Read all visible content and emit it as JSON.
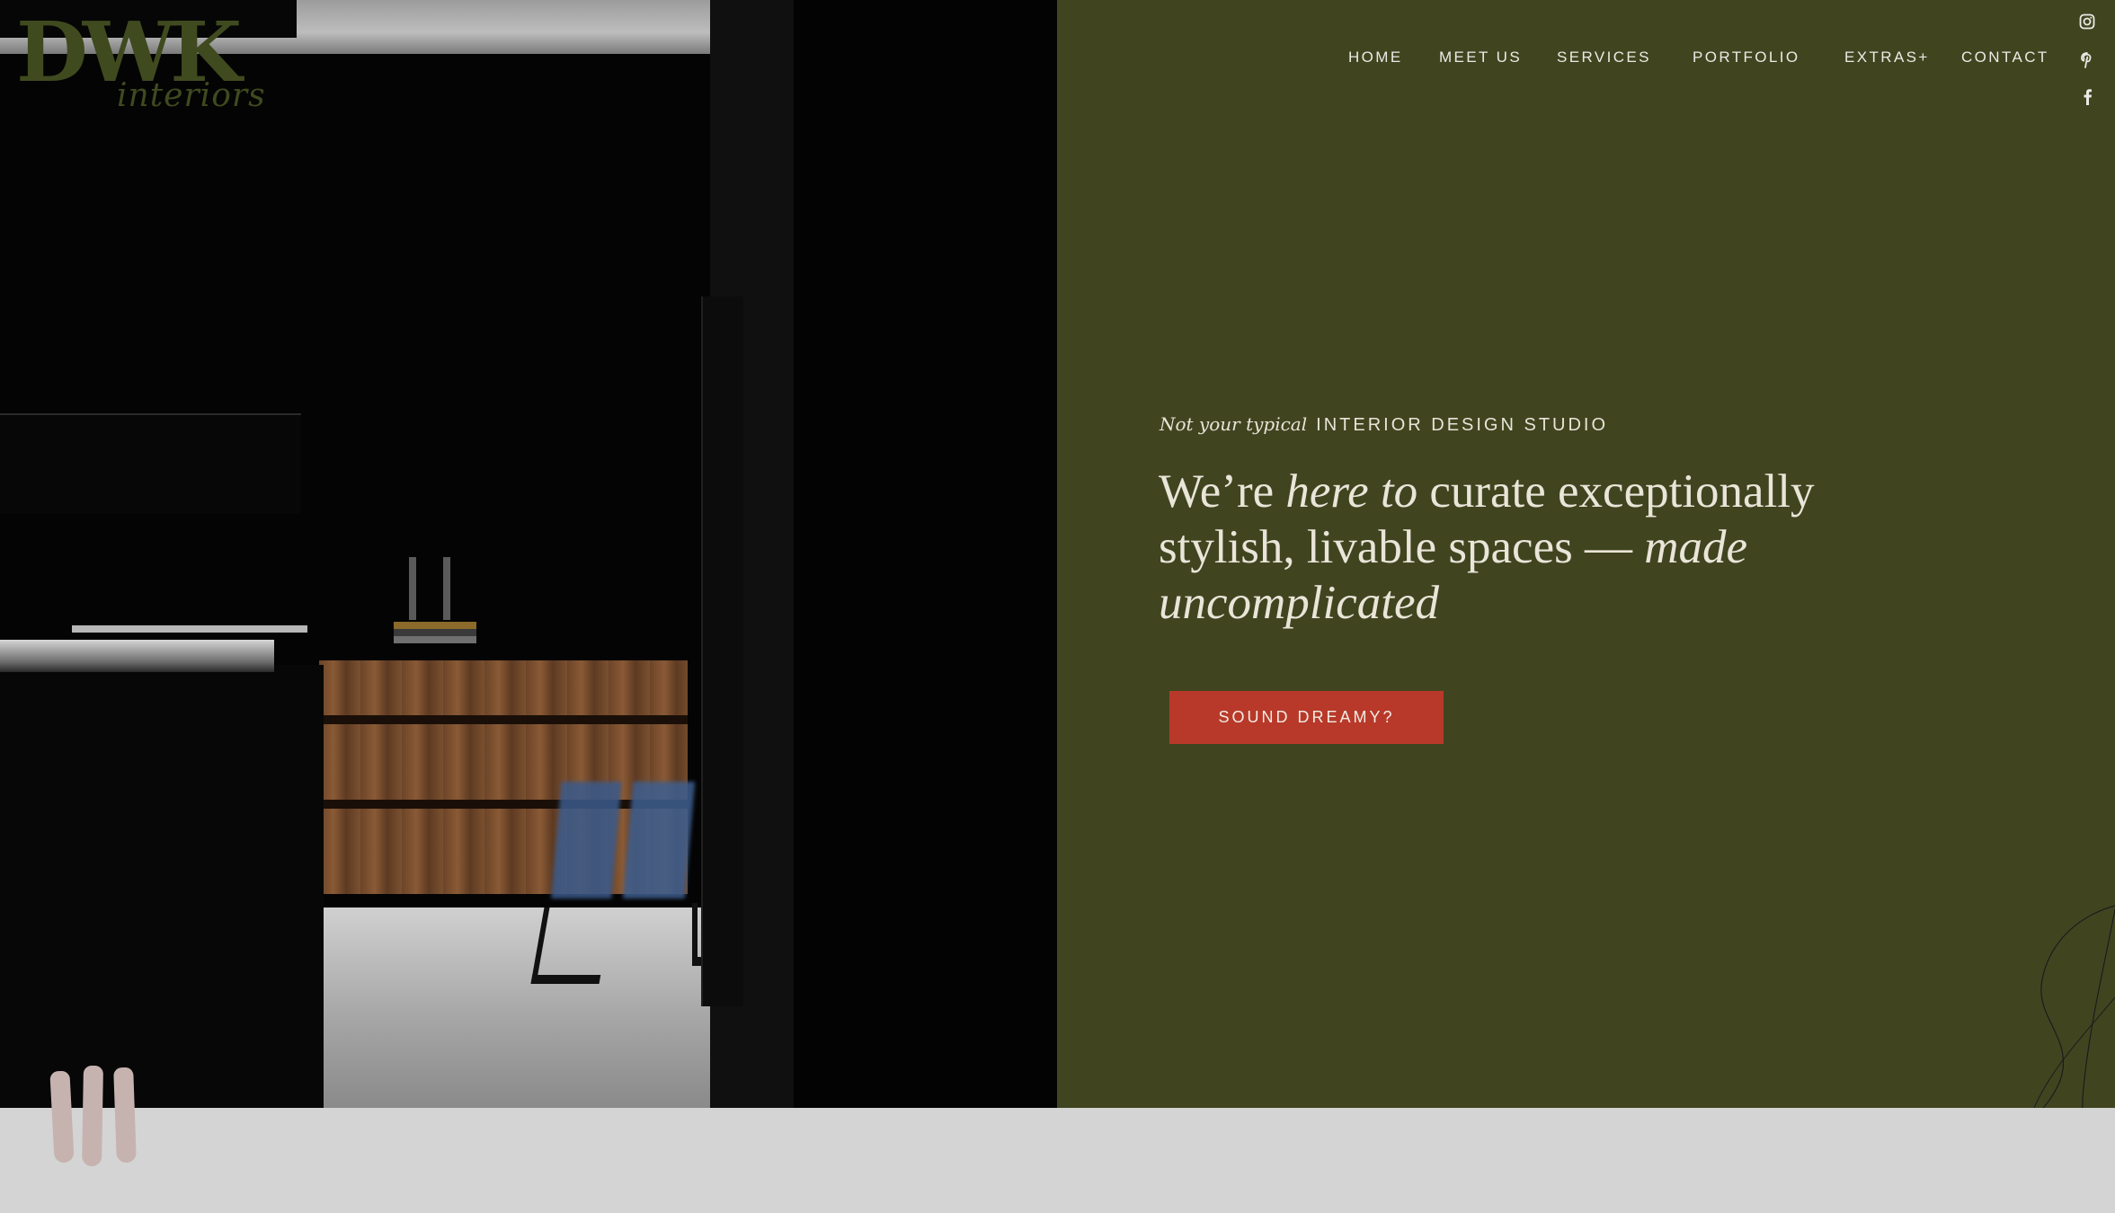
{
  "logo": {
    "mark": "DWK",
    "script": "interiors"
  },
  "nav": {
    "items": [
      "HOME",
      "MEET US",
      "SERVICES",
      "PORTFOLIO",
      "EXTRAS+",
      "CONTACT"
    ]
  },
  "social": {
    "icons": [
      "instagram-icon",
      "pinterest-icon",
      "facebook-icon"
    ]
  },
  "hero": {
    "eyebrow_italic": "Not your typical",
    "eyebrow_caps": "INTERIOR DESIGN STUDIO",
    "headline": {
      "part1": "We’re ",
      "italic1": "here to",
      "part2": " curate exceptionally stylish, livable spaces — ",
      "italic2": "made uncomplicated"
    },
    "cta_label": "SOUND DREAMY?"
  },
  "colors": {
    "panel_green": "#404520",
    "cta_red": "#b8392a",
    "text_light": "#e9e5d8",
    "strip_gray": "#d4d4d4",
    "brand_pink": "#c6b3b0"
  }
}
